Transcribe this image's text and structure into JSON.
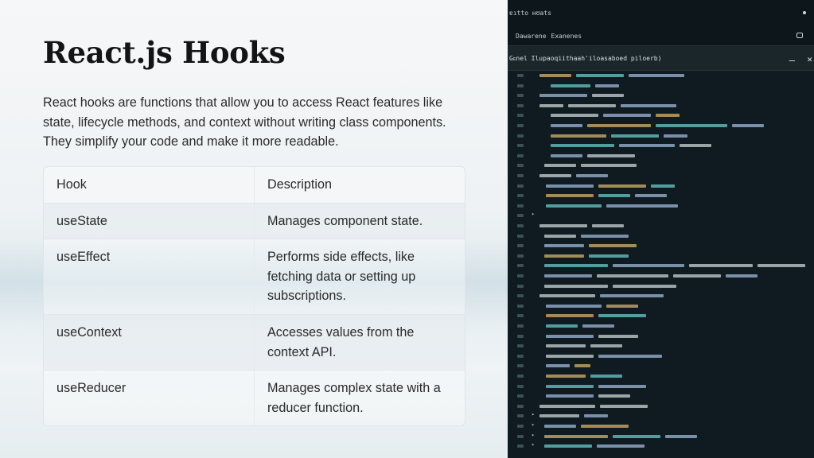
{
  "slide": {
    "title": "React.js Hooks",
    "intro": "React hooks are functions that allow you to access React features like state, lifecycle methods, and context without writing class components. They simplify your code and make it more readable.",
    "table": {
      "headers": [
        "Hook",
        "Description"
      ],
      "rows": [
        [
          "useState",
          "Manages component state."
        ],
        [
          "useEffect",
          "Performs side effects, like fetching data or setting up subscriptions."
        ],
        [
          "useContext",
          "Accesses values from the context API."
        ],
        [
          "useReducer",
          "Manages complex state with a reducer function."
        ]
      ]
    }
  },
  "editor": {
    "window_title": "ɐıtto ʜʊats",
    "menu": [
      "Dawarene",
      "Exanenes"
    ],
    "tab_title": "Gᴇnel Ilupaoqiithaah'iloasaboed piloerb)",
    "minimize_label": "–",
    "close_label": "✕",
    "colors": {
      "background": "#0f1b20",
      "keyword": "#d4b36a",
      "string": "#6cc9c9",
      "ident": "#9fb7d8",
      "plain": "#c9d4d6"
    }
  }
}
